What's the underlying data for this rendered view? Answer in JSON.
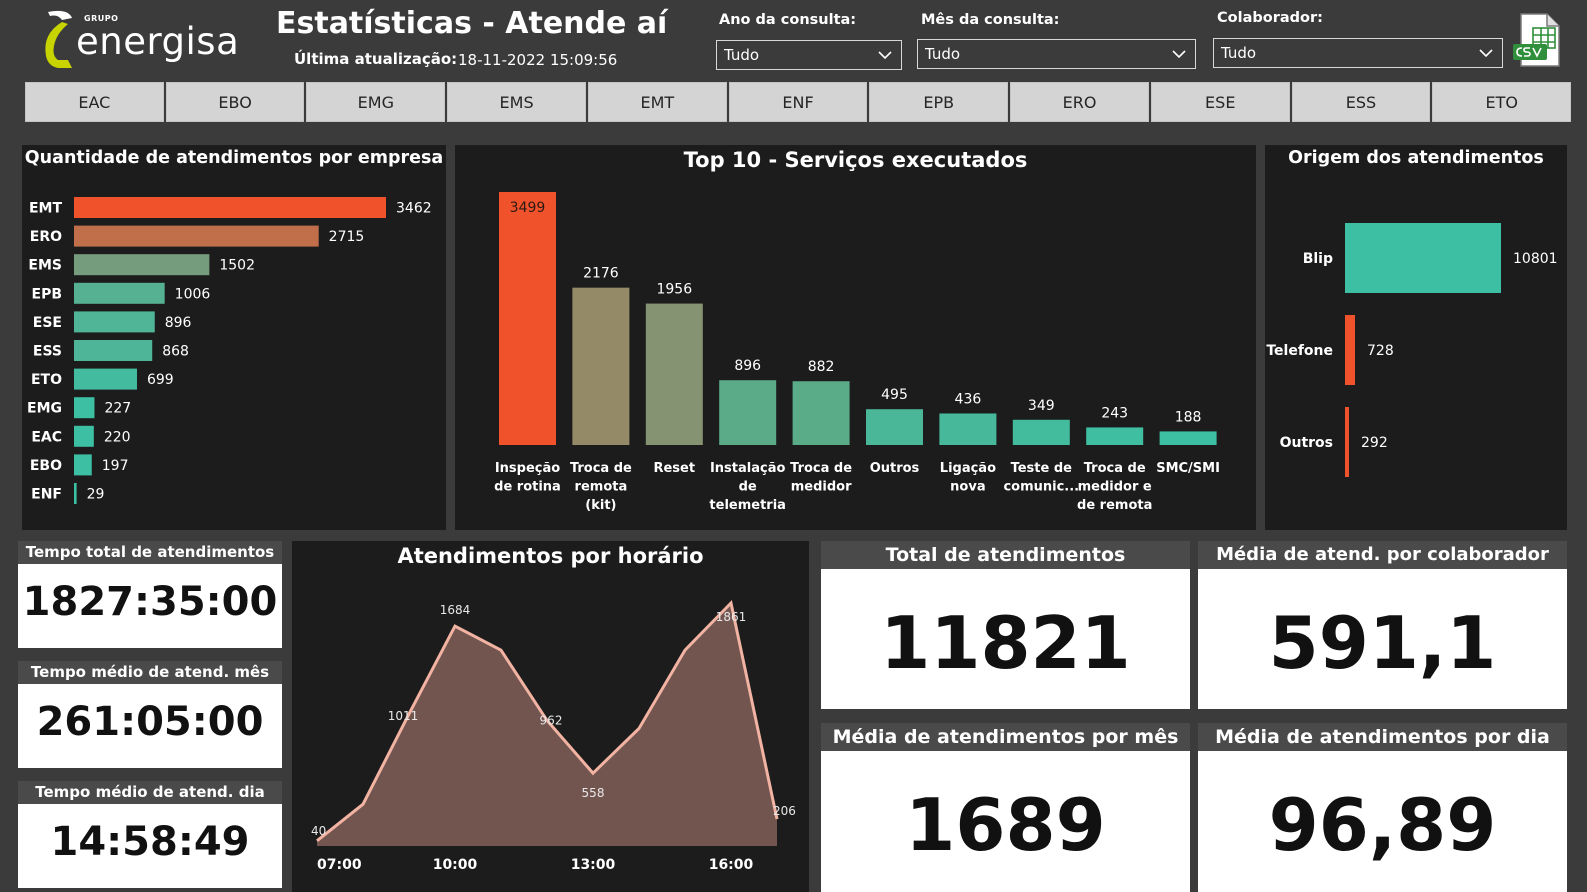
{
  "header": {
    "logo_group": "GRUPO",
    "logo_word": "energisa",
    "title": "Estatísticas - Atende aí",
    "updated_label": "Última atualização:",
    "updated_value": "18-11-2022 15:09:56"
  },
  "filters": {
    "year": {
      "label": "Ano da consulta:",
      "value": "Tudo"
    },
    "month": {
      "label": "Mês da consulta:",
      "value": "Tudo"
    },
    "collaborator": {
      "label": "Colaborador:",
      "value": "Tudo"
    }
  },
  "export_icon": "csv-file-icon",
  "tabs": [
    "EAC",
    "EBO",
    "EMG",
    "EMS",
    "EMT",
    "ENF",
    "EPB",
    "ERO",
    "ESE",
    "ESS",
    "ETO"
  ],
  "panels": {
    "by_company": {
      "title": "Quantidade de atendimentos por empresa"
    },
    "top_services": {
      "title": "Top 10 - Serviços executados"
    },
    "origin": {
      "title": "Origem dos atendimentos"
    },
    "by_hour": {
      "title": "Atendimentos por horário"
    }
  },
  "kpis": {
    "total_time": {
      "label": "Tempo total de atendimentos",
      "value": "1827:35:00"
    },
    "avg_time_month": {
      "label": "Tempo médio de atend. mês",
      "value": "261:05:00"
    },
    "avg_time_day": {
      "label": "Tempo médio de atend. dia",
      "value": "14:58:49"
    },
    "total": {
      "label": "Total de atendimentos",
      "value": "11821"
    },
    "avg_per_collaborator": {
      "label": "Média de atend. por colaborador",
      "value": "591,1"
    },
    "avg_per_month": {
      "label": "Média de atendimentos por mês",
      "value": "1689"
    },
    "avg_per_day": {
      "label": "Média de atendimentos por dia",
      "value": "96,89"
    }
  },
  "colors": {
    "orange": "#f0532b",
    "teal": "#3dbfa3",
    "area_fill": "#735550",
    "area_line": "#f2b3a3"
  },
  "chart_data": [
    {
      "type": "bar",
      "orientation": "horizontal",
      "categories": [
        "EMT",
        "ERO",
        "EMS",
        "EPB",
        "ESE",
        "ESS",
        "ETO",
        "EMG",
        "EAC",
        "EBO",
        "ENF"
      ],
      "values": [
        3462,
        2715,
        1502,
        1006,
        896,
        868,
        699,
        227,
        220,
        197,
        29
      ]
    },
    {
      "type": "bar",
      "categories": [
        [
          "Inspeção",
          "de rotina"
        ],
        [
          "Troca de",
          "remota",
          "(kit)"
        ],
        [
          "Reset"
        ],
        [
          "Instalação",
          "de",
          "telemetria"
        ],
        [
          "Troca de",
          "medidor"
        ],
        [
          "Outros"
        ],
        [
          "Ligação",
          "nova"
        ],
        [
          "Teste de",
          "comunic..."
        ],
        [
          "Troca de",
          "medidor e",
          "de remota"
        ],
        [
          "SMC/SMI"
        ]
      ],
      "values": [
        3499,
        2176,
        1956,
        896,
        882,
        495,
        436,
        349,
        243,
        188
      ]
    },
    {
      "type": "bar",
      "orientation": "horizontal",
      "categories": [
        "Blip",
        "Telefone",
        "Outros"
      ],
      "values": [
        10801,
        728,
        292
      ]
    },
    {
      "type": "area",
      "x": [
        7,
        8,
        9,
        10,
        11,
        12,
        13,
        14,
        15,
        16,
        17
      ],
      "values": [
        40,
        320,
        1011,
        1684,
        1500,
        962,
        558,
        900,
        1500,
        1861,
        206
      ],
      "labeled_points": [
        {
          "x": 7,
          "value": 40
        },
        {
          "x": 9,
          "value": 1011
        },
        {
          "x": 10,
          "value": 1684
        },
        {
          "x": 12,
          "value": 962
        },
        {
          "x": 13,
          "value": 558
        },
        {
          "x": 16,
          "value": 1861
        },
        {
          "x": 17,
          "value": 206
        }
      ],
      "x_tick_labels": [
        "07:00",
        "10:00",
        "13:00",
        "16:00"
      ]
    }
  ]
}
